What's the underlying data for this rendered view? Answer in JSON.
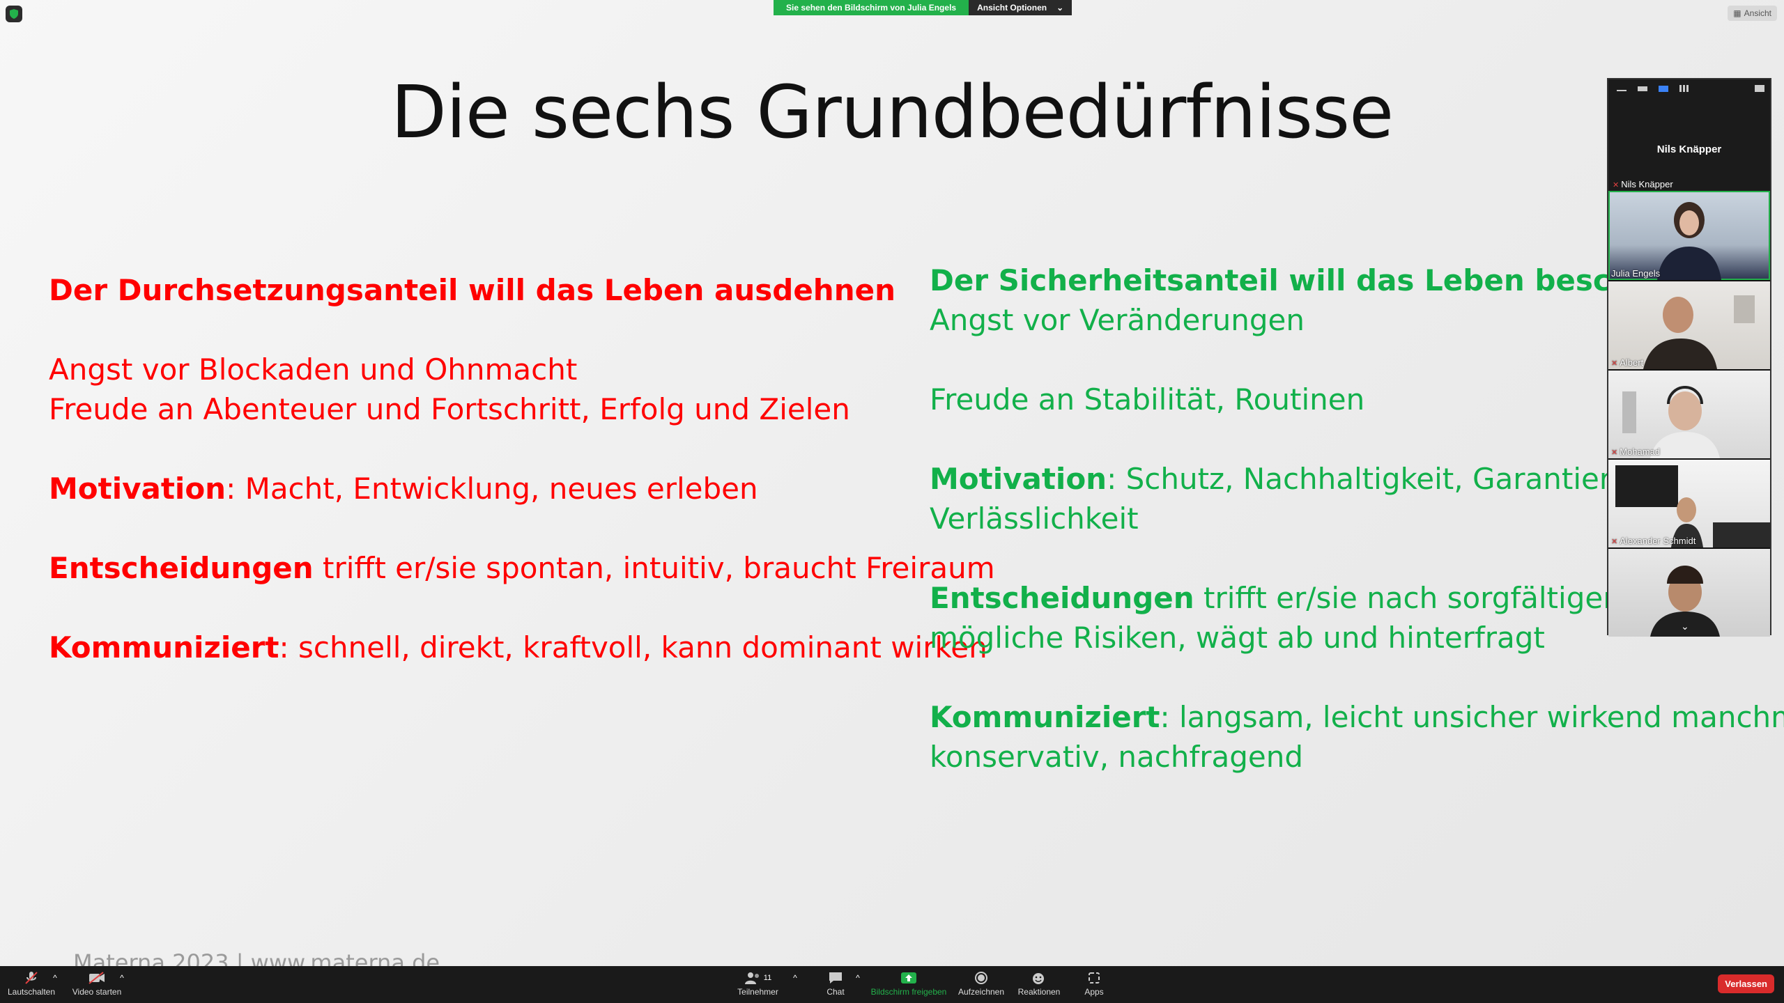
{
  "slide": {
    "title": "Die sechs Grundbedürfnisse",
    "left": {
      "heading": "Der Durchsetzungsanteil will das Leben ausdehnen",
      "line1": "Angst vor Blockaden und Ohnmacht",
      "line2": "Freude an Abenteuer und Fortschritt, Erfolg und Zielen",
      "motivation_label": "Motivation",
      "motivation_text": ": Macht, Entwicklung, neues erleben",
      "entscheidungen_label": "Entscheidungen",
      "entscheidungen_text": " trifft er/sie spontan, intuitiv, braucht Freiraum",
      "kommuniziert_label": "Kommuniziert",
      "kommuniziert_text": ": schnell, direkt, kraftvoll, kann dominant wirken"
    },
    "right": {
      "heading": "Der Sicherheitsanteil will das Leben beschützen",
      "line1": "Angst vor Veränderungen",
      "line2": "Freude an Stabilität, Routinen",
      "motivation_label": "Motivation",
      "motivation_text": ": Schutz, Nachhaltigkeit, Garantieren,",
      "motivation_text2": "Verlässlichkeit",
      "entscheidungen_label": "Entscheidungen",
      "entscheidungen_text": " trifft er/sie nach sorgfältiger Prüfu",
      "entscheidungen_text2": "mögliche Risiken, wägt ab und hinterfragt",
      "kommuniziert_label": "Kommuniziert",
      "kommuniziert_text": ": langsam, leicht unsicher wirkend manchmal",
      "kommuniziert_text2": "konservativ, nachfragend"
    },
    "footer": "Materna 2023 | www.materna.de"
  },
  "share_banner": {
    "text": "Sie sehen den Bildschirm von Julia Engels",
    "options": "Ansicht Optionen"
  },
  "view_button": "Ansicht",
  "panel": {
    "speaker": "Nils Knäpper",
    "speaker_tag": "Nils Knäpper",
    "tiles": [
      {
        "name": "Julia Engels"
      },
      {
        "name": "Albert"
      },
      {
        "name": "Mohamad"
      },
      {
        "name": "Alexander Schmidt"
      },
      {
        "name": ""
      }
    ]
  },
  "toolbar": {
    "mute": "Lautschalten",
    "video": "Video starten",
    "participants": "Teilnehmer",
    "participants_count": "11",
    "chat": "Chat",
    "share": "Bildschirm freigeben",
    "record": "Aufzeichnen",
    "reactions": "Reaktionen",
    "apps": "Apps",
    "leave": "Verlassen"
  },
  "colors": {
    "left_text": "#ff0000",
    "right_text": "#12b04a",
    "share_green": "#23b14b",
    "leave_red": "#d92b2b"
  }
}
